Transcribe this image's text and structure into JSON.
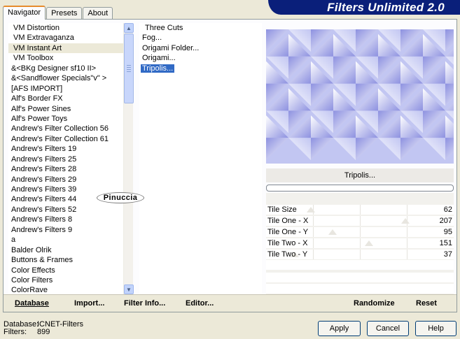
{
  "window": {
    "title": "Filters Unlimited 2.0"
  },
  "tabs": [
    {
      "label": "Navigator",
      "active": true
    },
    {
      "label": "Presets",
      "active": false
    },
    {
      "label": "About",
      "active": false
    }
  ],
  "categories": [
    "VM Distortion",
    "VM Extravaganza",
    "VM Instant Art",
    "VM Toolbox",
    "&<BKg Designer sf10 II>",
    "&<Sandflower Specials\"v\" >",
    "[AFS IMPORT]",
    "Alf's Border FX",
    "Alf's Power Sines",
    "Alf's Power Toys",
    "Andrew's Filter Collection 56",
    "Andrew's Filter Collection 61",
    "Andrew's Filters 19",
    "Andrew's Filters 25",
    "Andrew's Filters 28",
    "Andrew's Filters 29",
    "Andrew's Filters 39",
    "Andrew's Filters 44",
    "Andrew's Filters 52",
    "Andrew's Filters 8",
    "Andrew's Filters 9",
    "a",
    "Balder Olrik",
    "Buttons & Frames",
    "Color Effects",
    "Color Filters",
    "ColorRave"
  ],
  "selected_category": "VM Instant Art",
  "filters": [
    "Three Cuts",
    "Fog...",
    "Origami Folder...",
    "Origami...",
    "Tripolis..."
  ],
  "selected_filter": "Tripolis...",
  "preview": {
    "filter_name": "Tripolis...",
    "colors": [
      "#c2c6f2",
      "#8d91e0",
      "#ffffff"
    ]
  },
  "params": [
    {
      "label": "Tile Size",
      "value": 62,
      "max": 255
    },
    {
      "label": "Tile One - X",
      "value": 207,
      "max": 255
    },
    {
      "label": "Tile One - Y",
      "value": 95,
      "max": 255
    },
    {
      "label": "Tile Two - X",
      "value": 151,
      "max": 255
    },
    {
      "label": "Tile Two - Y",
      "value": 37,
      "max": 255
    }
  ],
  "toolbar": {
    "database": "Database",
    "import": "Import...",
    "filter_info": "Filter Info...",
    "editor": "Editor...",
    "randomize": "Randomize",
    "reset": "Reset"
  },
  "footer": {
    "database_label": "Database:",
    "database_value": "ICNET-Filters",
    "filters_label": "Filters:",
    "filters_value": "899",
    "apply": "Apply",
    "cancel": "Cancel",
    "help": "Help"
  },
  "watermark": "Pinuccia",
  "colors": {
    "title_bg": "#0a1f7a",
    "selection": "#316ac5",
    "tab_accent": "#e68b2c"
  }
}
